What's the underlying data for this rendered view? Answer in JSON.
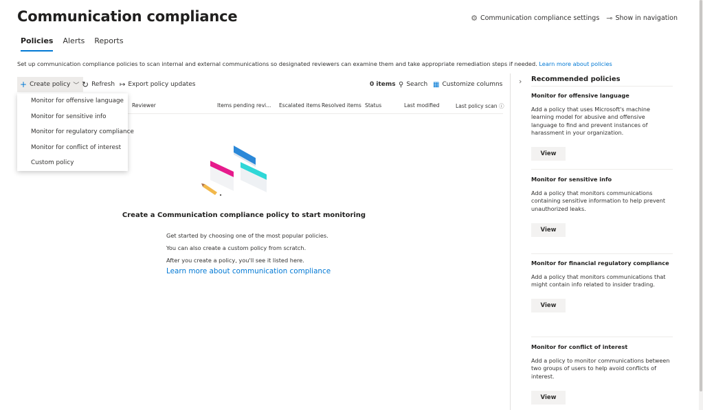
{
  "page": {
    "title": "Communication compliance",
    "settings_label": "Communication compliance settings",
    "show_nav_label": "Show in navigation",
    "description": "Set up communication compliance policies to scan internal and external communications so designated reviewers can examine them and take appropriate remediation steps if needed.",
    "description_link": "Learn more about policies"
  },
  "tabs": [
    {
      "label": "Policies",
      "active": true
    },
    {
      "label": "Alerts",
      "active": false
    },
    {
      "label": "Reports",
      "active": false
    }
  ],
  "toolbar": {
    "create_label": "Create policy",
    "refresh_label": "Refresh",
    "export_label": "Export policy updates",
    "items_count": "0 items",
    "search_label": "Search",
    "customize_label": "Customize columns"
  },
  "columns": {
    "reviewer": "Reviewer",
    "items_pending": "Items pending revi...",
    "escalated": "Escalated items",
    "resolved": "Resolved items",
    "status": "Status",
    "last_modified": "Last modified",
    "last_scan": "Last policy scan"
  },
  "create_menu": [
    "Monitor for offensive language",
    "Monitor for sensitive info",
    "Monitor for regulatory compliance",
    "Monitor for conflict of interest",
    "Custom policy"
  ],
  "empty_state": {
    "title": "Create a Communication compliance policy to start monitoring",
    "lines": [
      "Get started by choosing one of the most popular policies.",
      "You can also create a custom policy from scratch.",
      "After you create a policy, you'll see it listed here."
    ],
    "link": "Learn more about communication compliance"
  },
  "recommended": {
    "title": "Recommended policies",
    "cards": [
      {
        "title": "Monitor for offensive language",
        "desc": "Add a policy that uses Microsoft's machine learning model for abusive and offensive language to find and prevent instances of harassment in your organization.",
        "button": "View"
      },
      {
        "title": "Monitor for sensitive info",
        "desc": "Add a policy that monitors communications containing sensitive information to help prevent unauthorized leaks.",
        "button": "View"
      },
      {
        "title": "Monitor for financial regulatory compliance",
        "desc": "Add a policy that monitors communications that might contain info related to insider trading.",
        "button": "View"
      },
      {
        "title": "Monitor for conflict of interest",
        "desc": "Add a policy to monitor communications between two groups of users to help avoid conflicts of interest.",
        "button": "View"
      }
    ]
  },
  "icons": {
    "settings": "gear-icon",
    "pin": "pin-icon",
    "add": "add-icon",
    "refresh": "refresh-icon",
    "export": "export-arrow-icon",
    "search": "search-icon",
    "customize": "customize-columns-icon",
    "info": "info-icon",
    "panel_toggle": "chevron-right-icon"
  },
  "colors": {
    "accent": "#0078d4",
    "text": "#323130",
    "button_bg": "#f3f2f1"
  }
}
